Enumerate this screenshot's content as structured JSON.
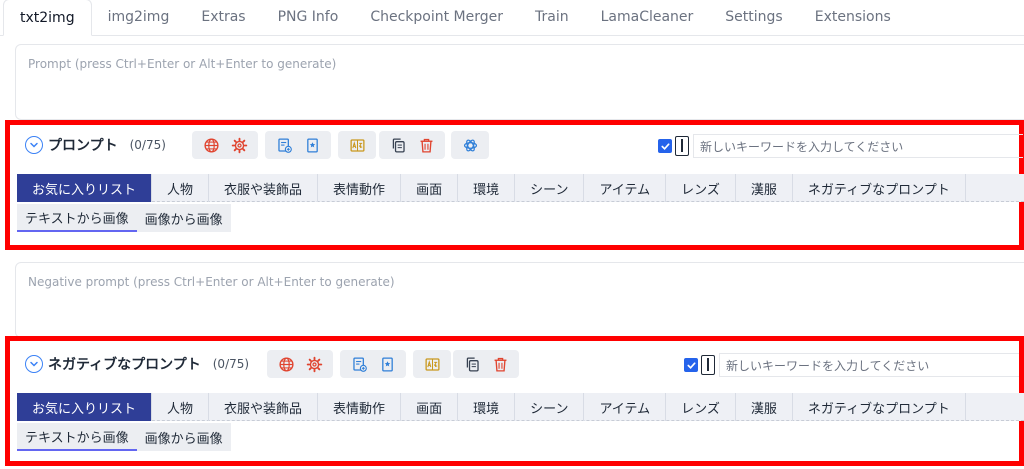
{
  "tabs": [
    {
      "label": "txt2img",
      "active": true
    },
    {
      "label": "img2img"
    },
    {
      "label": "Extras"
    },
    {
      "label": "PNG Info"
    },
    {
      "label": "Checkpoint Merger"
    },
    {
      "label": "Train"
    },
    {
      "label": "LamaCleaner"
    },
    {
      "label": "Settings"
    },
    {
      "label": "Extensions"
    }
  ],
  "prompt": {
    "placeholder": "Prompt (press Ctrl+Enter or Alt+Enter to generate)"
  },
  "negative_prompt": {
    "placeholder": "Negative prompt (press Ctrl+Enter or Alt+Enter to generate)"
  },
  "panels": [
    {
      "title": "プロンプト",
      "count": "(0/75)",
      "keyword_placeholder": "新しいキーワードを入力してください",
      "categories": [
        "お気に入りリスト",
        "人物",
        "衣服や装飾品",
        "表情動作",
        "画面",
        "環境",
        "シーン",
        "アイテム",
        "レンズ",
        "漢服",
        "ネガティブなプロンプト"
      ],
      "subtabs": [
        "テキストから画像",
        "画像から画像"
      ]
    },
    {
      "title": "ネガティブなプロンプト",
      "count": "(0/75)",
      "keyword_placeholder": "新しいキーワードを入力してください",
      "categories": [
        "お気に入りリスト",
        "人物",
        "衣服や装飾品",
        "表情動作",
        "画面",
        "環境",
        "シーン",
        "アイテム",
        "レンズ",
        "漢服",
        "ネガティブなプロンプト"
      ],
      "subtabs": [
        "テキストから画像",
        "画像から画像"
      ]
    }
  ],
  "colors": {
    "highlight": "#ff0000",
    "active_category": "#2f3e97",
    "accent": "#3b82f6",
    "icon_red": "#e0442f",
    "icon_blue": "#2f7fd8",
    "icon_gold": "#c9971c"
  },
  "icons": [
    "globe-icon",
    "settings-gear-icon",
    "document-add-icon",
    "bookmark-icon",
    "translate-icon",
    "copy-icon",
    "trash-icon",
    "openai-icon"
  ]
}
